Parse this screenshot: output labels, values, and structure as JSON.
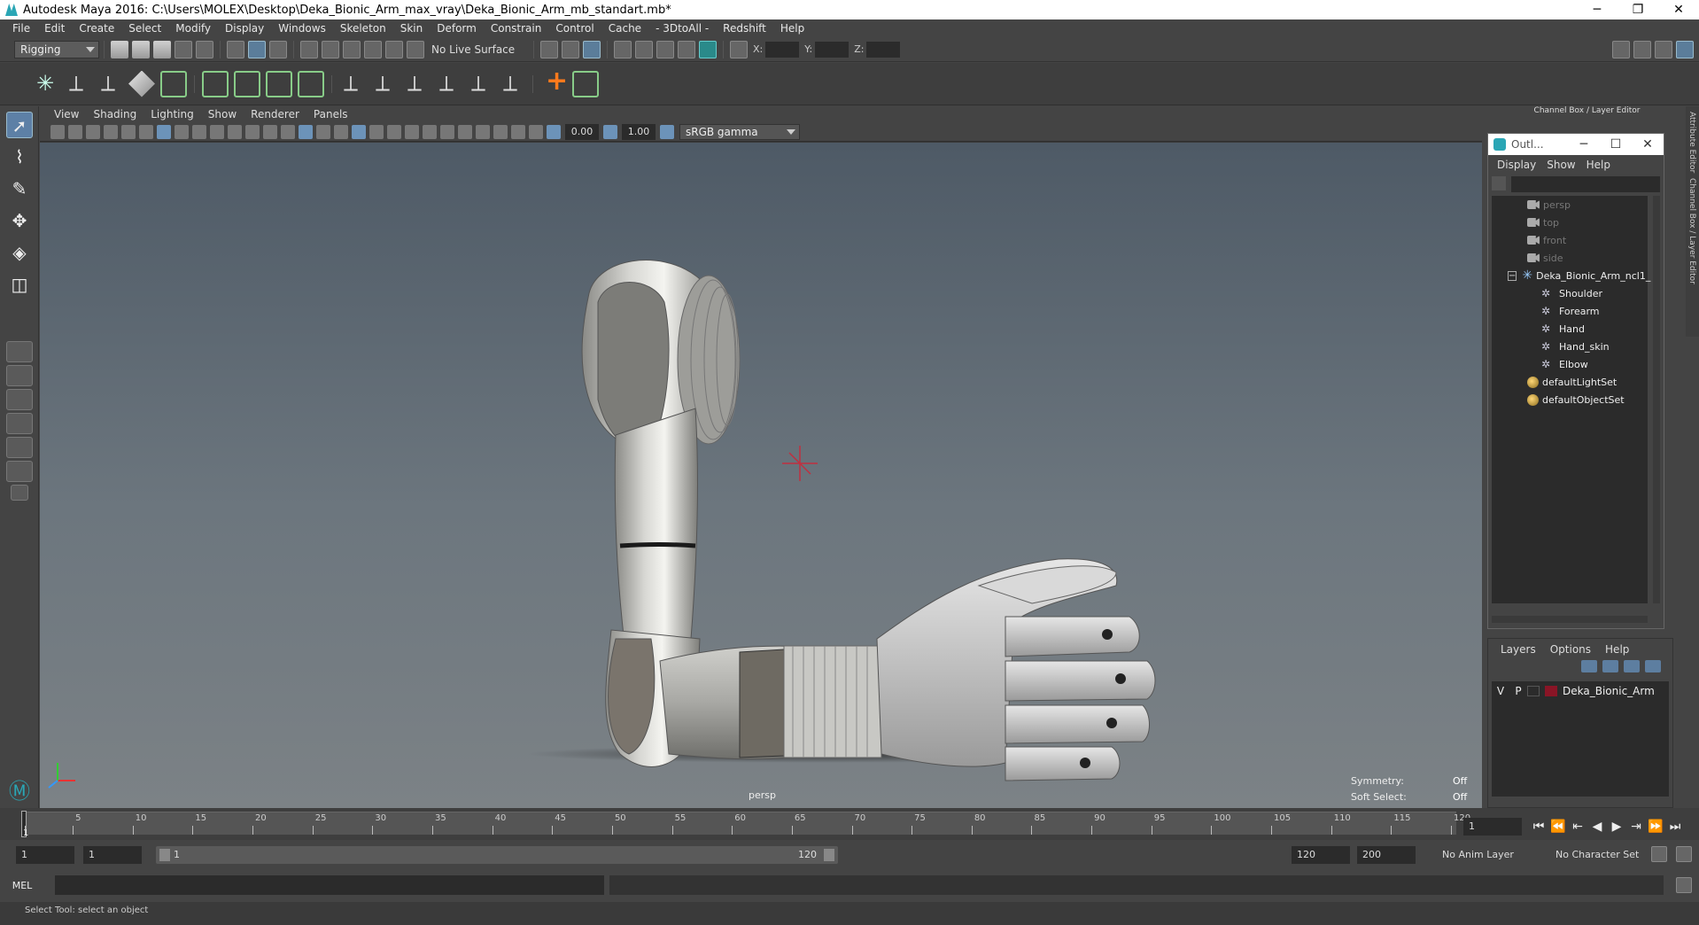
{
  "window": {
    "title": "Autodesk Maya 2016: C:\\Users\\MOLEX\\Desktop\\Deka_Bionic_Arm_max_vray\\Deka_Bionic_Arm_mb_standart.mb*",
    "minimize": "─",
    "maximize": "❐",
    "close": "✕"
  },
  "menubar": {
    "items": [
      "File",
      "Edit",
      "Create",
      "Select",
      "Modify",
      "Display",
      "Windows",
      "Skeleton",
      "Skin",
      "Deform",
      "Constrain",
      "Control",
      "Cache",
      "- 3DtoAll -",
      "Redshift",
      "Help"
    ]
  },
  "statusline": {
    "mode": "Rigging",
    "live_surface": "No Live Surface",
    "x_label": "X:",
    "y_label": "Y:",
    "z_label": "Z:"
  },
  "viewport": {
    "menu": [
      "View",
      "Shading",
      "Lighting",
      "Show",
      "Renderer",
      "Panels"
    ],
    "exposure": "0.00",
    "gamma_value": "1.00",
    "colorspace": "sRGB gamma",
    "camera_label": "persp",
    "symmetry_label": "Symmetry:",
    "symmetry_value": "Off",
    "softselect_label": "Soft Select:",
    "softselect_value": "Off"
  },
  "channelbox": {
    "title": "Channel Box / Layer Editor"
  },
  "outliner": {
    "title": "Outl...",
    "menu": [
      "Display",
      "Show",
      "Help"
    ],
    "items": [
      {
        "label": "persp",
        "icon": "camera-icon",
        "dim": true,
        "indent": 0
      },
      {
        "label": "top",
        "icon": "camera-icon",
        "dim": true,
        "indent": 0
      },
      {
        "label": "front",
        "icon": "camera-icon",
        "dim": true,
        "indent": 0
      },
      {
        "label": "side",
        "icon": "camera-icon",
        "dim": true,
        "indent": 0
      },
      {
        "label": "Deka_Bionic_Arm_ncl1_",
        "icon": "group-icon",
        "dim": false,
        "indent": 0
      },
      {
        "label": "Shoulder",
        "icon": "joint-icon",
        "dim": false,
        "indent": 1
      },
      {
        "label": "Forearm",
        "icon": "joint-icon",
        "dim": false,
        "indent": 1
      },
      {
        "label": "Hand",
        "icon": "joint-icon",
        "dim": false,
        "indent": 1
      },
      {
        "label": "Hand_skin",
        "icon": "joint-icon",
        "dim": false,
        "indent": 1
      },
      {
        "label": "Elbow",
        "icon": "joint-icon",
        "dim": false,
        "indent": 1
      },
      {
        "label": "defaultLightSet",
        "icon": "set-icon",
        "dim": false,
        "indent": 0
      },
      {
        "label": "defaultObjectSet",
        "icon": "set-icon",
        "dim": false,
        "indent": 0
      }
    ]
  },
  "layers": {
    "menu": [
      "Layers",
      "Options",
      "Help"
    ],
    "rows": [
      {
        "v": "V",
        "p": "P",
        "name": "Deka_Bionic_Arm",
        "color": "#8a1526"
      }
    ]
  },
  "sidetabs": [
    "Attribute Editor",
    "Channel Box / Layer Editor"
  ],
  "timeline": {
    "ticks": [
      1,
      5,
      10,
      15,
      20,
      25,
      30,
      35,
      40,
      45,
      50,
      55,
      60,
      65,
      70,
      75,
      80,
      85,
      90,
      95,
      100,
      105,
      110,
      115,
      120
    ],
    "current_frame": "1",
    "frame_field": "1"
  },
  "range": {
    "start": "1",
    "playback_start": "1",
    "slider_left": "1",
    "slider_right": "120",
    "playback_end": "120",
    "end": "200",
    "anim_layer": "No Anim Layer",
    "character_set": "No Character Set"
  },
  "cmdline": {
    "label": "MEL"
  },
  "helpline": {
    "text": "Select Tool: select an object"
  }
}
